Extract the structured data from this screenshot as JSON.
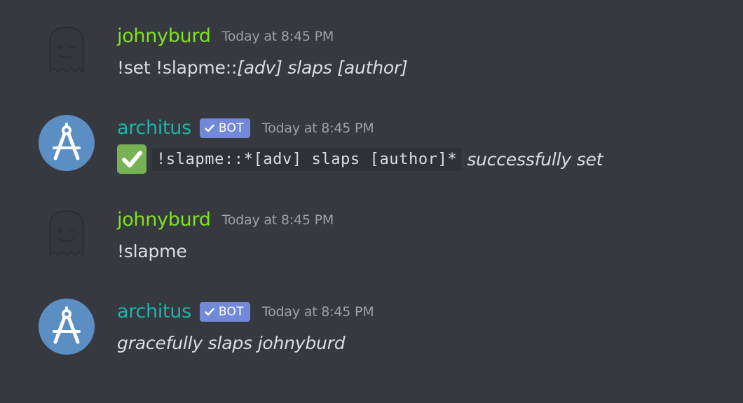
{
  "messages": [
    {
      "author": "johnyburd",
      "is_bot": false,
      "timestamp": "Today at 8:45 PM",
      "text_plain": "!set !slapme::",
      "text_italic": "[adv] slaps [author]"
    },
    {
      "author": "architus",
      "is_bot": true,
      "bot_tag": "BOT",
      "timestamp": "Today at 8:45 PM",
      "emoji": "white-check-mark",
      "code": "!slapme::*[adv] slaps [author]*",
      "text_italic": "successfully set"
    },
    {
      "author": "johnyburd",
      "is_bot": false,
      "timestamp": "Today at 8:45 PM",
      "text_plain": "!slapme"
    },
    {
      "author": "architus",
      "is_bot": true,
      "bot_tag": "BOT",
      "timestamp": "Today at 8:45 PM",
      "text_italic": "gracefully slaps johnyburd"
    }
  ],
  "colors": {
    "background": "#36393f",
    "user_name": "#7fe31b",
    "bot_name": "#1fb5a8",
    "bot_tag": "#7289da",
    "timestamp": "#9ea1a6",
    "text": "#dcddde",
    "code_background": "#2f3136",
    "check_emoji": "#77b255",
    "bot_avatar": "#5b8fc4"
  }
}
